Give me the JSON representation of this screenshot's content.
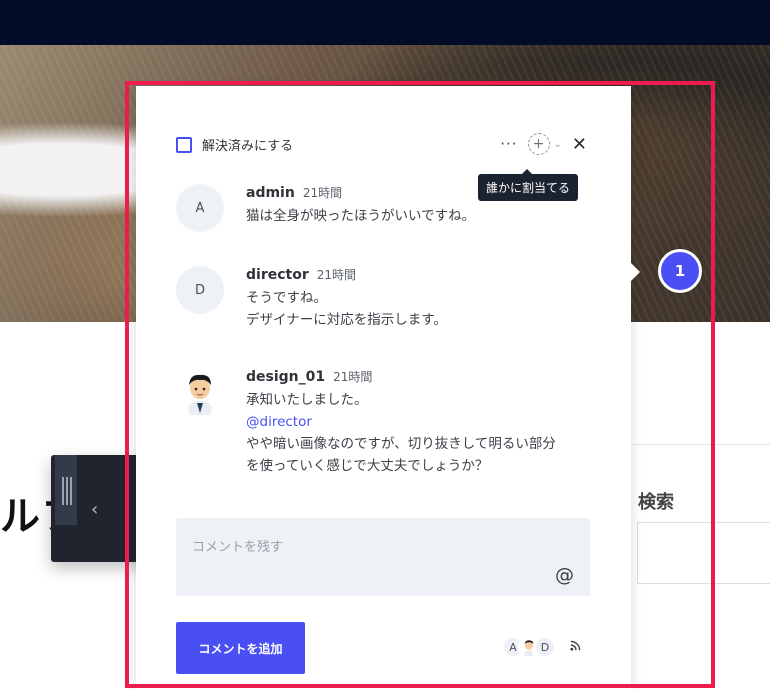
{
  "background": {
    "page_heading": "ルフ",
    "side_title": "検索"
  },
  "pin": {
    "number": "1"
  },
  "header": {
    "resolve_label": "解決済みにする",
    "more_glyph": "···",
    "assign_glyph": "+",
    "caret_glyph": "⌄",
    "close_glyph": "✕",
    "tooltip": "誰かに割当てる"
  },
  "comments": [
    {
      "avatar": "A",
      "author": "admin",
      "time": "21時間",
      "text": "猫は全身が映ったほうがいいですね。"
    },
    {
      "avatar": "D",
      "author": "director",
      "time": "21時間",
      "text": "そうですね。\nデザイナーに対応を指示します。"
    },
    {
      "avatar": "",
      "author": "design_01",
      "time": "21時間",
      "text_before": "承知いたしました。",
      "mention": "@director",
      "text": "やや暗い画像なのですが、切り抜きして明るい部分\nを使っていく感じで大丈夫でしょうか？"
    }
  ],
  "composer": {
    "placeholder": "コメントを残す",
    "at_glyph": "@",
    "submit_label": "コメントを追加"
  },
  "participants": [
    "A",
    "",
    "D"
  ],
  "colors": {
    "accent": "#4a4ff4",
    "highlight": "#ee1b4f",
    "topbar": "#020c26"
  }
}
